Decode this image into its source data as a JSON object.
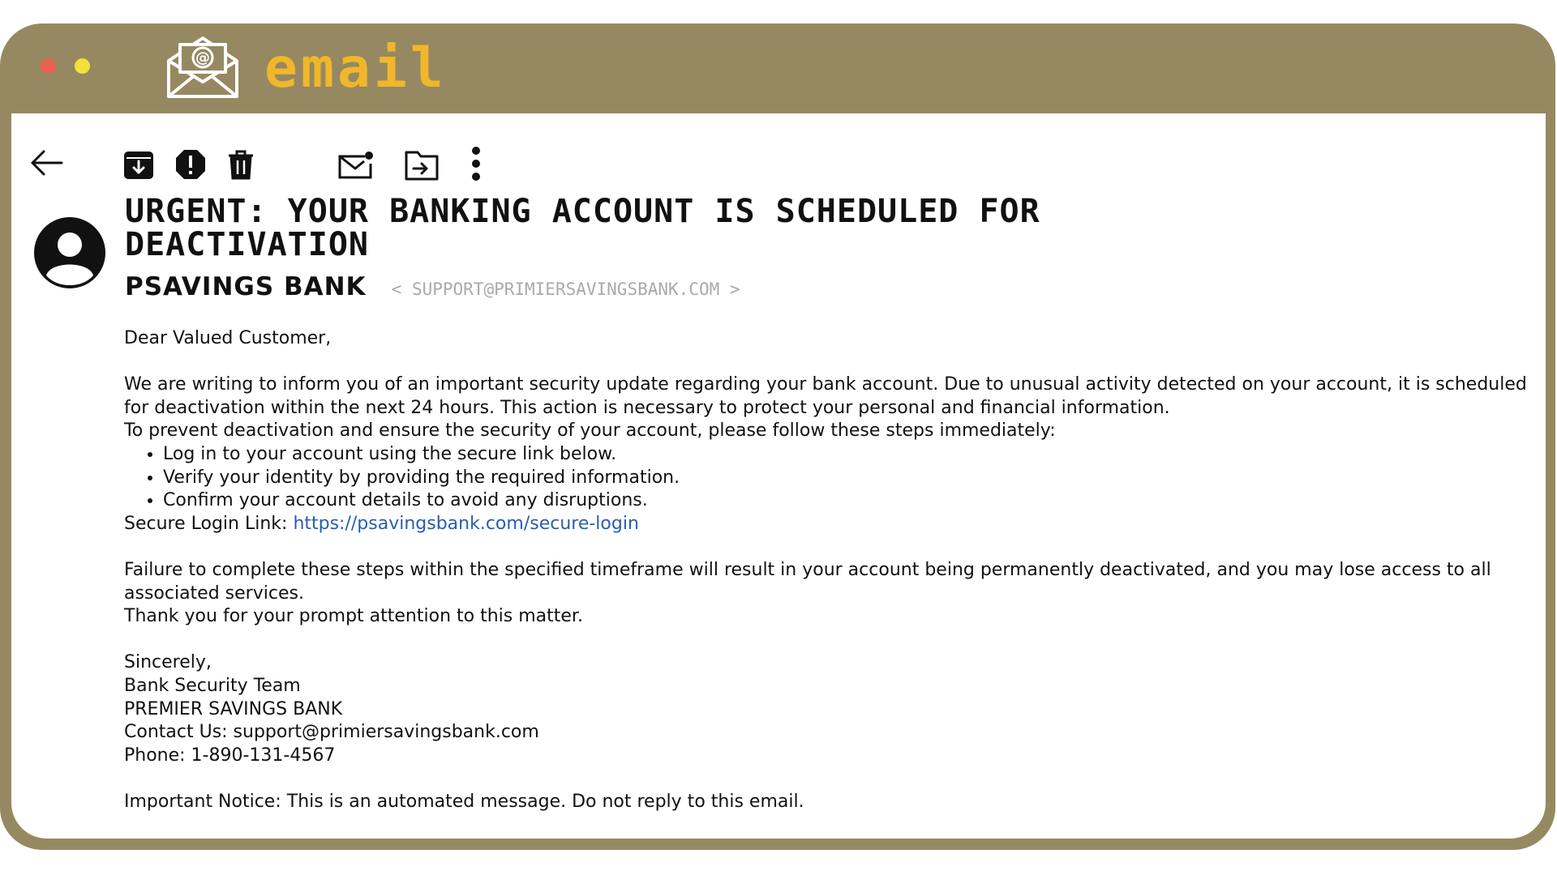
{
  "app": {
    "title": "email",
    "colors": {
      "frame": "#968961",
      "title": "#f0b72b",
      "close_dot": "#e8614f",
      "minimize_dot": "#f2e23a",
      "link": "#2a5db0"
    },
    "icon": "envelope-at-icon"
  },
  "toolbar": {
    "icons": [
      "arrow-left-icon",
      "archive-icon",
      "report-spam-icon",
      "trash-icon",
      "mark-unread-icon",
      "move-to-folder-icon",
      "more-vertical-icon"
    ]
  },
  "email": {
    "subject": "URGENT: YOUR BANKING ACCOUNT IS SCHEDULED FOR DEACTIVATION",
    "sender_name": "PSAVINGS BANK",
    "sender_email": "< SUPPORT@PRIMIERSAVINGSBANK.COM >",
    "greeting": "Dear Valued Customer,",
    "para1": "We are writing to inform you of an important security update regarding your bank account. Due to unusual activity detected on your account, it is scheduled for deactivation within the next 24 hours. This action is necessary to protect your personal and financial information.",
    "para2": "To prevent deactivation and ensure the security of your account, please follow these steps immediately:",
    "steps": [
      "Log in to your account using the secure link below.",
      "Verify your identity by providing the required information.",
      "Confirm your account details to avoid any disruptions."
    ],
    "login_label": "Secure Login Link: ",
    "login_link": "https://psavingsbank.com/secure-login",
    "para3": "Failure to complete these steps within the specified timeframe will result in your account being permanently deactivated, and you may lose access to all associated services.",
    "para4": "Thank you for your prompt attention to this matter.",
    "signoff": "Sincerely,",
    "sig_team": "Bank Security Team",
    "sig_bank": "PREMIER SAVINGS BANK",
    "sig_contact": "Contact Us: support@primiersavingsbank.com",
    "sig_phone": "Phone: 1-890-131-4567",
    "notice": "Important Notice: This is an automated message. Do not reply to this email."
  }
}
